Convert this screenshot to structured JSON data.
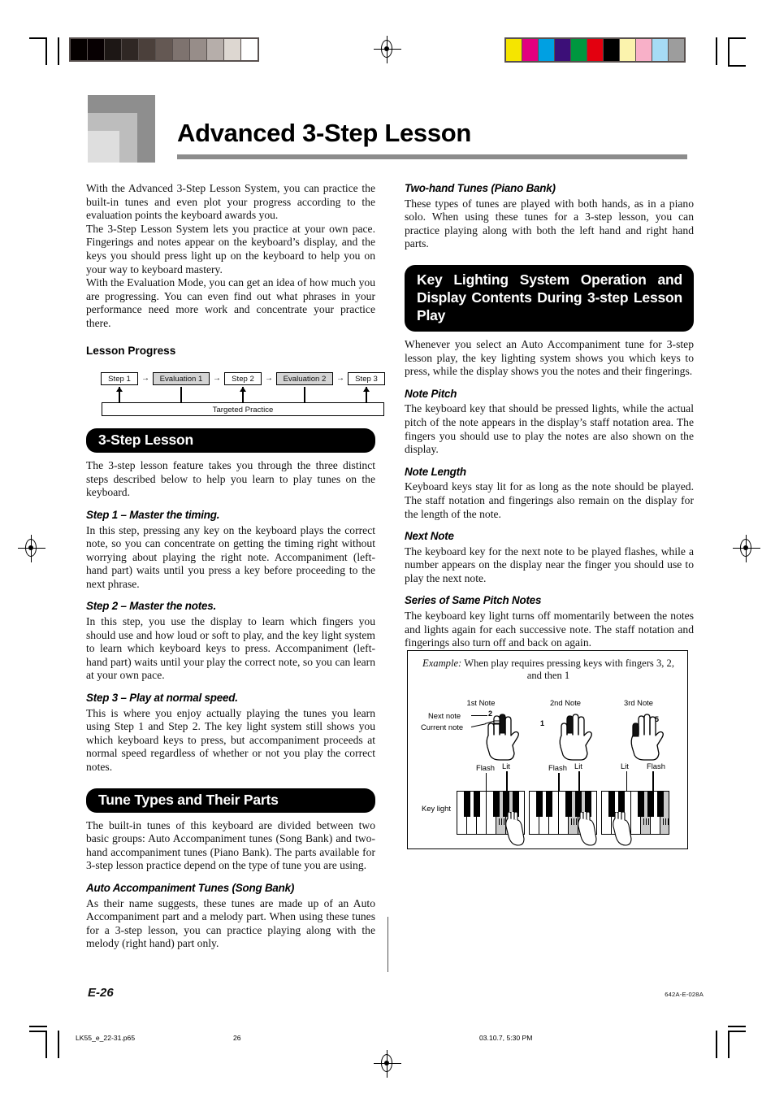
{
  "page": {
    "title": "Advanced 3-Step Lesson",
    "footer_page": "E-26",
    "footer_code": "642A-E-028A",
    "slug_file": "LK55_e_22-31.p65",
    "slug_page": "26",
    "slug_date": "03.10.7, 5:30 PM",
    "accent_gray": "#8c8c8c",
    "bar_color": "#000000"
  },
  "printmarks": {
    "grayscale": [
      "#050000",
      "#070002",
      "#1d1715",
      "#2f2724",
      "#4b403b",
      "#645853",
      "#7e736f",
      "#978d89",
      "#b6aeaa",
      "#ddd7d1",
      "#ffffff"
    ],
    "colors": [
      "#f5e500",
      "#e2007f",
      "#00a0e2",
      "#3c0f78",
      "#00973f",
      "#e3000f",
      "#000000",
      "#fbf3ad",
      "#f8b0c8",
      "#a6dbf5",
      "#9d9d9d"
    ]
  },
  "left": {
    "intro_p1": "With the Advanced 3-Step Lesson System, you can practice the built-in tunes and even plot your progress according to the evaluation points the keyboard awards you.",
    "intro_p2": "The 3-Step Lesson System lets you practice at your own pace. Fingerings and notes appear on the keyboard’s display, and the keys you should press light up on the keyboard to help you on your way to keyboard mastery.",
    "intro_p3": "With the Evaluation Mode, you can get an idea of how much you are progressing. You can even find out what phrases in your performance need more work and concentrate your practice there.",
    "lesson_progress_heading": "Lesson Progress",
    "flow": {
      "nodes": [
        {
          "label": "Step 1",
          "shaded": false
        },
        {
          "label": "Evaluation 1",
          "shaded": true
        },
        {
          "label": "Step 2",
          "shaded": false
        },
        {
          "label": "Evaluation 2",
          "shaded": true
        },
        {
          "label": "Step 3",
          "shaded": false
        }
      ],
      "connector": "→",
      "targeted_practice": "Targeted Practice",
      "vertical_arrows": [
        "up",
        "down",
        "up",
        "down",
        "up"
      ]
    },
    "section1_title": "3-Step Lesson",
    "section1_body": "The 3-step lesson feature takes you through the three distinct steps described below to help you learn to play tunes on the keyboard.",
    "step1_title": "Step 1 – Master the timing.",
    "step1_body": "In this step, pressing any key on the keyboard plays the correct note, so you can concentrate on getting the timing right without worrying about playing the right note. Accompaniment (left-hand part) waits until you press a key before proceeding to the next phrase.",
    "step2_title": "Step 2 – Master the notes.",
    "step2_body": "In this step, you use the display to learn which fingers you should use and how loud or soft to play, and the key light system to learn which keyboard keys to press. Accompaniment (left-hand part) waits until your play the correct note, so you can learn at your own pace.",
    "step3_title": "Step 3 – Play at normal speed.",
    "step3_body": "This is where you enjoy actually playing the tunes you learn using Step 1 and Step 2. The key light system still shows you which keyboard keys to press, but accompaniment proceeds at normal speed regardless of whether or not you play the correct notes.",
    "section2_title": "Tune Types and Their Parts",
    "section2_body": "The built-in tunes of this keyboard are divided between two basic groups: Auto Accompaniment tunes (Song Bank) and two-hand accompaniment tunes (Piano Bank). The parts available for 3-step lesson practice depend on the type of tune you are using.",
    "auto_title": "Auto Accompaniment Tunes (Song Bank)",
    "auto_body": "As their name suggests, these tunes are made up of an Auto Accompaniment part and a melody part. When using these tunes for a 3-step lesson, you can practice playing along with the melody (right hand) part only."
  },
  "right": {
    "twohand_title": "Two-hand Tunes (Piano Bank)",
    "twohand_body": "These types of tunes are played with both hands, as in a piano solo. When using these tunes for a 3-step lesson, you can practice playing along with both the left hand and right hand parts.",
    "section3_title": "Key Lighting System Operation and Display Contents During 3-step Lesson Play",
    "section3_body": "Whenever you select an Auto Accompaniment tune for 3-step lesson play, the key lighting system shows you which keys to press, while the display shows you the notes and their fingerings.",
    "pitch_title": "Note Pitch",
    "pitch_body": "The keyboard key that should be pressed lights, while the actual pitch of the note appears in the display’s staff notation area. The fingers you should use to play the notes are also shown on the display.",
    "length_title": "Note Length",
    "length_body": "Keyboard keys stay lit for as long as the note should be played. The staff notation and fingerings also remain on the display for the length of the note.",
    "next_title": "Next Note",
    "next_body": "The keyboard key for the next note to be played flashes, while a number appears on the display near the finger you should use to play the next note.",
    "series_title": "Series of Same Pitch Notes",
    "series_body": "The keyboard key light turns off momentarily between the notes and lights again for each successive note. The staff notation and fingerings also turn off and back on again."
  },
  "figure": {
    "caption_em": "Example:",
    "caption_rest": "When play requires pressing keys with fingers 3, 2, and then 1",
    "note_headings": [
      "1st Note",
      "2nd Note",
      "3rd Note"
    ],
    "label_next": "Next note",
    "label_current": "Current note",
    "label_keylight": "Key light",
    "finger_numbers": [
      "2",
      "1",
      "5"
    ],
    "key_state_labels": [
      [
        "Flash",
        "Lit"
      ],
      [
        "Flash",
        "Lit"
      ],
      [
        "Lit",
        "Flash"
      ]
    ]
  }
}
